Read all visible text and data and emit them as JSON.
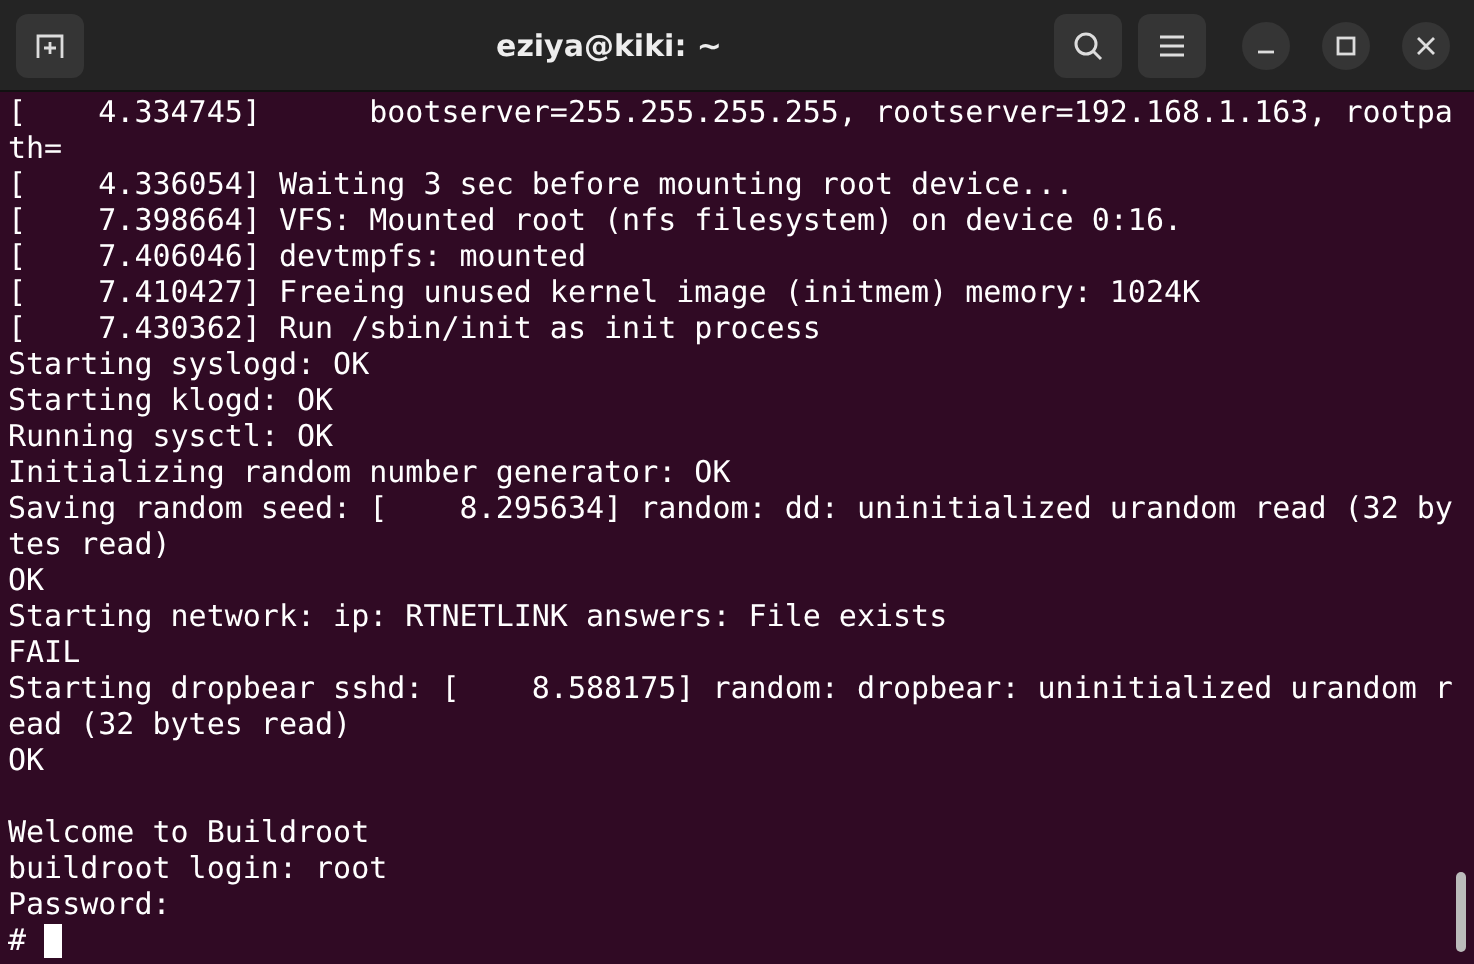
{
  "window": {
    "title": "eziya@kiki: ~"
  },
  "terminal": {
    "lines": [
      {
        "kind": "text",
        "text": "[    4.334745]      bootserver=255.255.255.255, rootserver=192.168.1.163, rootpa"
      },
      {
        "kind": "text",
        "text": "th="
      },
      {
        "kind": "text",
        "text": "[    4.336054] Waiting 3 sec before mounting root device..."
      },
      {
        "kind": "text",
        "text": "[    7.398664] VFS: Mounted root (nfs filesystem) on device 0:16."
      },
      {
        "kind": "text",
        "text": "[    7.406046] devtmpfs: mounted"
      },
      {
        "kind": "text",
        "text": "[    7.410427] Freeing unused kernel image (initmem) memory: 1024K"
      },
      {
        "kind": "text",
        "text": "[    7.430362] Run /sbin/init as init process"
      },
      {
        "kind": "text",
        "text": "Starting syslogd: OK"
      },
      {
        "kind": "text",
        "text": "Starting klogd: OK"
      },
      {
        "kind": "text",
        "text": "Running sysctl: OK"
      },
      {
        "kind": "text",
        "text": "Initializing random number generator: OK"
      },
      {
        "kind": "text",
        "text": "Saving random seed: [    8.295634] random: dd: uninitialized urandom read (32 by"
      },
      {
        "kind": "text",
        "text": "tes read)"
      },
      {
        "kind": "text",
        "text": "OK"
      },
      {
        "kind": "text",
        "text": "Starting network: ip: RTNETLINK answers: File exists"
      },
      {
        "kind": "text",
        "text": "FAIL"
      },
      {
        "kind": "text",
        "text": "Starting dropbear sshd: [    8.588175] random: dropbear: uninitialized urandom r"
      },
      {
        "kind": "text",
        "text": "ead (32 bytes read)"
      },
      {
        "kind": "text",
        "text": "OK"
      },
      {
        "kind": "blank"
      },
      {
        "kind": "text",
        "text": "Welcome to Buildroot"
      },
      {
        "kind": "text",
        "text": "buildroot login: root"
      },
      {
        "kind": "text",
        "text": "Password:"
      },
      {
        "kind": "prompt",
        "text": "#"
      }
    ]
  }
}
